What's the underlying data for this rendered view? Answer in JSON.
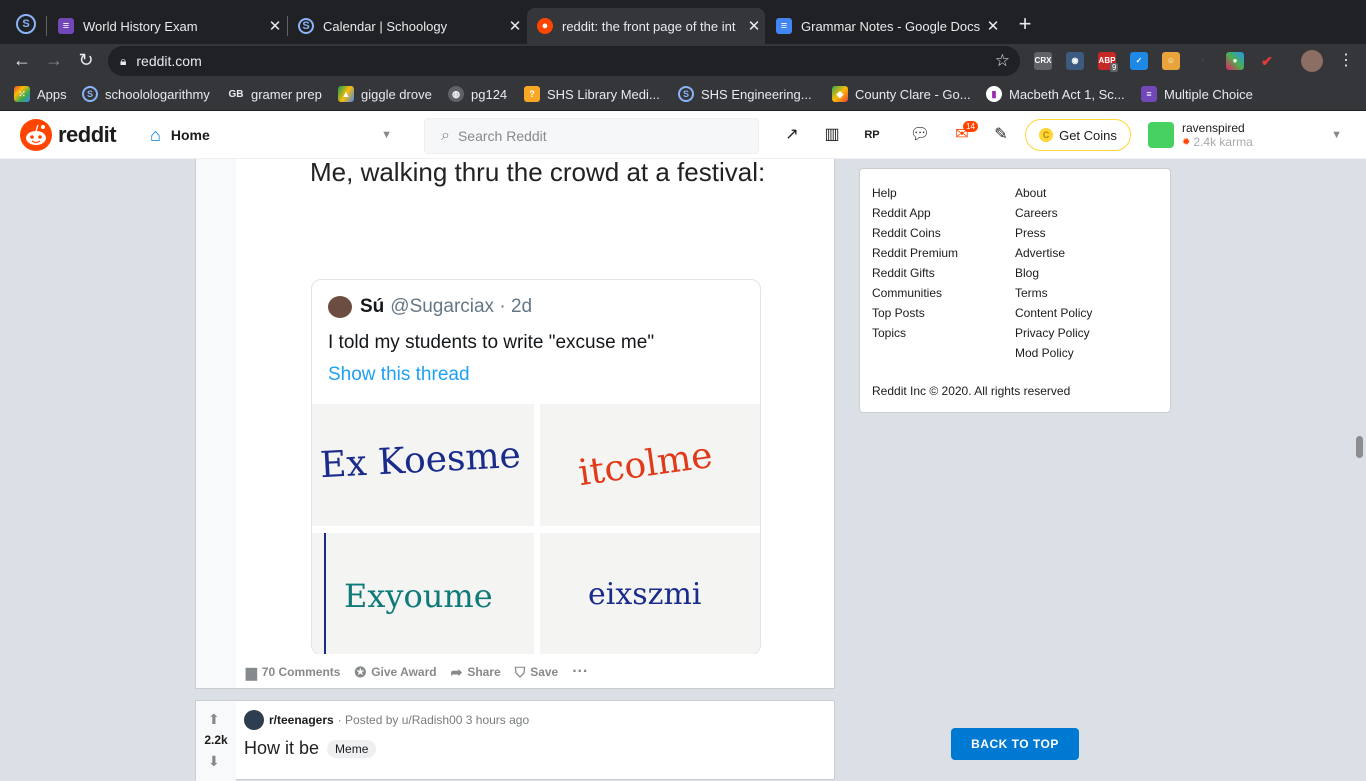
{
  "browser": {
    "tabs": [
      {
        "title": "World History Exam"
      },
      {
        "title": "Calendar | Schoology"
      },
      {
        "title": "reddit: the front page of the int"
      },
      {
        "title": "Grammar Notes - Google Docs"
      }
    ],
    "url": "reddit.com",
    "bookmarks": [
      "Apps",
      "schoolologarithmy",
      "gramer prep",
      "giggle drove",
      "pg124",
      "SHS Library Medi...",
      "SHS Engineering...",
      "County Clare - Go...",
      "Macbeth Act 1, Sc...",
      "Multiple Choice"
    ],
    "ext_badge": "9"
  },
  "reddit_header": {
    "logo_text": "reddit",
    "home_label": "Home",
    "search_placeholder": "Search Reddit",
    "mail_badge": "14",
    "get_coins": "Get Coins",
    "username": "ravenspired",
    "karma": "2.4k karma"
  },
  "post1": {
    "meme_caption": "Me, walking thru the crowd at a festival:",
    "tweet": {
      "name": "Sú",
      "handle": "@Sugarciax · 2d",
      "text": "I told my students to write \"excuse me\"",
      "link": "Show this thread",
      "images": [
        "Ex Koesme",
        "itcolme",
        "Exyoume",
        "eixszmi"
      ]
    },
    "comments": "70 Comments",
    "give_award": "Give Award",
    "share": "Share",
    "save": "Save"
  },
  "post2": {
    "votes": "2.2k",
    "subreddit": "r/teenagers",
    "posted_by": "· Posted by u/Radish00 3 hours ago",
    "title": "How it be",
    "flair": "Meme"
  },
  "sidebar": {
    "col1": [
      "Help",
      "Reddit App",
      "Reddit Coins",
      "Reddit Premium",
      "Reddit Gifts",
      "Communities",
      "Top Posts",
      "Topics"
    ],
    "col2": [
      "About",
      "Careers",
      "Press",
      "Advertise",
      "Blog",
      "Terms",
      "Content Policy",
      "Privacy Policy",
      "Mod Policy"
    ],
    "copyright": "Reddit Inc © 2020. All rights reserved"
  },
  "back_to_top": "BACK TO TOP",
  "colors": {
    "reddit_orange": "#ff4500",
    "reddit_blue": "#0079d3",
    "twitter_blue": "#1da1f2",
    "coins_yellow": "#ffd635"
  }
}
